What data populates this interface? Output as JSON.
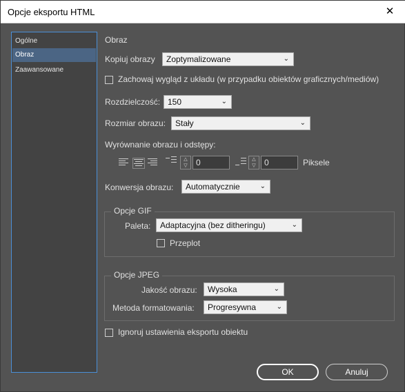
{
  "window": {
    "title": "Opcje eksportu HTML"
  },
  "sidebar": {
    "items": [
      {
        "label": "Ogólne",
        "active": false
      },
      {
        "label": "Obraz",
        "active": true
      },
      {
        "label": "Zaawansowane",
        "active": false
      }
    ]
  },
  "main": {
    "section_title": "Obraz",
    "copy_images": {
      "label": "Kopiuj obrazy",
      "value": "Zoptymalizowane"
    },
    "preserve_layout": {
      "label": "Zachowaj wygląd z układu (w przypadku obiektów graficznych/mediów)",
      "checked": false
    },
    "resolution": {
      "label": "Rozdzielczość:",
      "value": "150"
    },
    "image_size": {
      "label": "Rozmiar obrazu:",
      "value": "Stały"
    },
    "alignment": {
      "label": "Wyrównanie obrazu i odstępy:",
      "space_before": "0",
      "space_after": "0",
      "unit": "Piksele"
    },
    "conversion": {
      "label": "Konwersja obrazu:",
      "value": "Automatycznie"
    },
    "gif": {
      "title": "Opcje GIF",
      "palette_label": "Paleta:",
      "palette_value": "Adaptacyjna (bez ditheringu)",
      "interlace_label": "Przeplot",
      "interlace_checked": false
    },
    "jpeg": {
      "title": "Opcje JPEG",
      "quality_label": "Jakość obrazu:",
      "quality_value": "Wysoka",
      "method_label": "Metoda formatowania:",
      "method_value": "Progresywna"
    },
    "ignore_export": {
      "label": "Ignoruj ustawienia eksportu obiektu",
      "checked": false
    }
  },
  "buttons": {
    "ok": "OK",
    "cancel": "Anuluj"
  },
  "icons": {
    "close": "close-icon",
    "chevron": "chevron-down-icon"
  }
}
